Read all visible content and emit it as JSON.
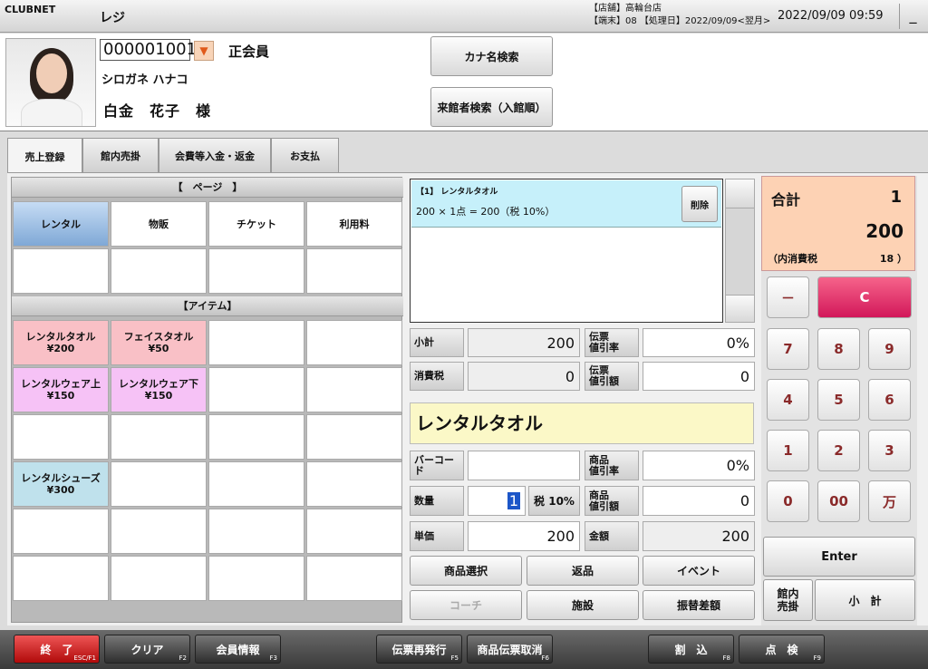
{
  "titlebar": {
    "brand": "CLUBNET",
    "title": "レジ",
    "store": "【店舗】高輪台店",
    "terminal": "【端末】08 【処理日】2022/09/09<翌月>",
    "clock": "2022/09/09 09:59",
    "minimize": "_"
  },
  "member": {
    "id": "000001001",
    "type": "正会員",
    "kana": "シロガネ ハナコ",
    "name": "白金　花子　様",
    "btn_kana": "カナ名検索",
    "btn_visitor": "来館者検索（入館順）"
  },
  "tabs": [
    "売上登録",
    "館内売掛",
    "会費等入金・返金",
    "お支払"
  ],
  "page": {
    "header": "【　ページ　】",
    "items": [
      "レンタル",
      "物販",
      "チケット",
      "利用料",
      "",
      "",
      "",
      ""
    ]
  },
  "items": {
    "header": "【アイテム】",
    "cells": [
      "レンタルタオル\n¥200",
      "フェイスタオル\n¥50",
      "",
      "",
      "レンタルウェア上\n¥150",
      "レンタルウェア下\n¥150",
      "",
      "",
      "",
      "",
      "",
      "",
      "レンタルシューズ\n¥300",
      "",
      "",
      "",
      "",
      "",
      "",
      "",
      "",
      "",
      "",
      ""
    ]
  },
  "cart": {
    "line1": "【1】 レンタルタオル",
    "line2": "200 × 1点 = 200（税 10%）",
    "delete": "削除"
  },
  "summary": {
    "subtotal_l": "小計",
    "subtotal_v": "200",
    "tax_l": "消費税",
    "tax_v": "0",
    "drate_l": "伝票\n値引率",
    "drate_v": "0%",
    "damt_l": "伝票\n値引額",
    "damt_v": "0"
  },
  "product": {
    "name": "レンタルタオル",
    "barcode_l": "バーコード",
    "barcode_v": "",
    "qty_l": "数量",
    "qty_v": "1",
    "tax_btn": "税 10%",
    "price_l": "単価",
    "price_v": "200",
    "prate_l": "商品\n値引率",
    "prate_v": "0%",
    "pamt_l": "商品\n値引額",
    "pamt_v": "0",
    "amount_l": "金額",
    "amount_v": "200"
  },
  "actions": [
    "商品選択",
    "返品",
    "イベント",
    "コーチ",
    "施設",
    "振替差額"
  ],
  "total": {
    "label": "合計",
    "count": "1",
    "amount": "200",
    "tax_l": "（内消費税",
    "tax_v": "18 ）"
  },
  "keys": [
    "7",
    "8",
    "9",
    "4",
    "5",
    "6",
    "1",
    "2",
    "3",
    "0",
    "00",
    "万"
  ],
  "keys_special": {
    "minus": "－",
    "clear": "C",
    "enter": "Enter",
    "credit": "館内\n売掛",
    "subtotal": "小　計"
  },
  "fkeys": [
    {
      "label": "終　了",
      "fn": "ESC/F1"
    },
    {
      "label": "クリア",
      "fn": "F2"
    },
    {
      "label": "会員情報",
      "fn": "F3"
    },
    {
      "label": "伝票再発行",
      "fn": "F5"
    },
    {
      "label": "商品伝票取消",
      "fn": "F6"
    },
    {
      "label": "割　込",
      "fn": "F8"
    },
    {
      "label": "点　検",
      "fn": "F9"
    }
  ]
}
